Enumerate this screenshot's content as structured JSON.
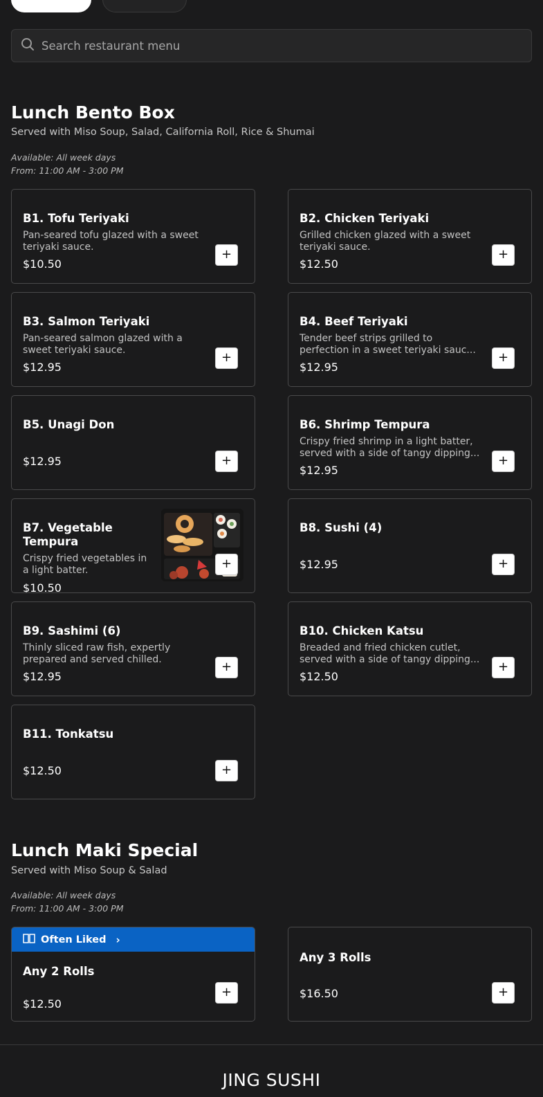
{
  "search": {
    "placeholder": "Search restaurant menu"
  },
  "sections": [
    {
      "title": "Lunch Bento Box",
      "description": "Served with Miso Soup, Salad, California Roll, Rice & Shumai",
      "available": "Available: All week days",
      "hours": "From: 11:00 AM - 3:00 PM",
      "items": [
        {
          "name": "B1. Tofu Teriyaki",
          "description": "Pan-seared tofu glazed with a sweet teriyaki sauce.",
          "price": "$10.50"
        },
        {
          "name": "B2. Chicken Teriyaki",
          "description": "Grilled chicken glazed with a sweet teriyaki sauce.",
          "price": "$12.50"
        },
        {
          "name": "B3. Salmon Teriyaki",
          "description": "Pan-seared salmon glazed with a sweet teriyaki sauce.",
          "price": "$12.95"
        },
        {
          "name": "B4. Beef Teriyaki",
          "description": "Tender beef strips grilled to perfection in a sweet teriyaki sauc...",
          "price": "$12.95"
        },
        {
          "name": "B5. Unagi Don",
          "description": "",
          "price": "$12.95"
        },
        {
          "name": "B6. Shrimp Tempura",
          "description": "Crispy fried shrimp in a light batter, served with a side of tangy dipping...",
          "price": "$12.95"
        },
        {
          "name": "B7. Vegetable Tempura",
          "description": "Crispy fried vegetables in a light batter.",
          "price": "$10.50"
        },
        {
          "name": "B8. Sushi (4)",
          "description": "",
          "price": "$12.95"
        },
        {
          "name": "B9. Sashimi (6)",
          "description": "Thinly sliced raw fish, expertly prepared and served chilled.",
          "price": "$12.95"
        },
        {
          "name": "B10. Chicken Katsu",
          "description": "Breaded and fried chicken cutlet, served with a side of tangy dipping...",
          "price": "$12.50"
        },
        {
          "name": "B11. Tonkatsu",
          "description": "",
          "price": "$12.50"
        }
      ]
    },
    {
      "title": "Lunch Maki Special",
      "description": "Served with Miso Soup & Salad",
      "available": "Available: All week days",
      "hours": "From: 11:00 AM - 3:00 PM",
      "items": [
        {
          "name": "Any 2 Rolls",
          "price": "$12.50",
          "badge": "Often Liked"
        },
        {
          "name": "Any 3 Rolls",
          "price": "$16.50"
        }
      ]
    }
  ],
  "add_label": "+",
  "chevron": "›",
  "brand": "JING SUSHI",
  "colors": {
    "background": "#1b1b1c",
    "badge": "#0a63c4",
    "card_border": "#4a4a4b"
  }
}
